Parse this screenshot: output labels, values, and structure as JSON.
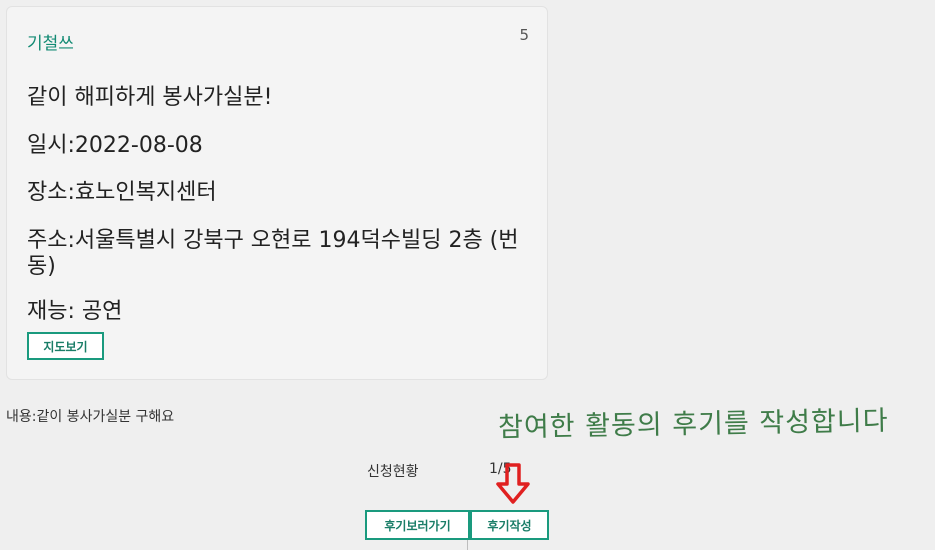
{
  "card": {
    "author": "기철쓰",
    "count": "5",
    "title": "같이 해피하게 봉사가실분!",
    "date": "일시:2022-08-08",
    "place": "장소:효노인복지센터",
    "address": "주소:서울특별시 강북구 오현로 194덕수빌딩 2층 (번동)",
    "talent": "재능: 공연",
    "map_button": "지도보기"
  },
  "content": "내용:같이 봉사가실분 구해요",
  "annotation": "참여한 활동의 후기를 작성합니다",
  "status": {
    "label": "신청현황",
    "value": "1/5"
  },
  "buttons": {
    "view_reviews": "후기보러가기",
    "write_review": "후기작성"
  },
  "colors": {
    "accent": "#1a9a7e",
    "annotation": "#3f7c49",
    "arrow": "#e02020"
  },
  "icons": {
    "annotation_arrow": "arrow-down-icon"
  }
}
